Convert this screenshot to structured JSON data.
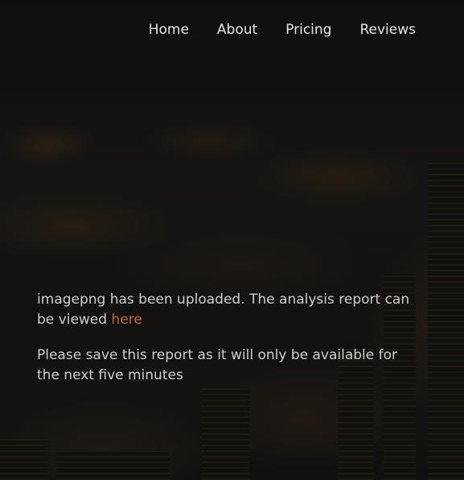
{
  "nav": {
    "items": [
      {
        "label": "Home"
      },
      {
        "label": "About"
      },
      {
        "label": "Pricing"
      },
      {
        "label": "Reviews"
      }
    ]
  },
  "message": {
    "upload_text": "imagepng has been uploaded. The analysis report can be viewed ",
    "link_label": "here",
    "save_notice": "Please save this report as it will only be available for the next five minutes"
  },
  "colors": {
    "link": "#c56b2e",
    "text": "#cfcfcf",
    "nav_text": "#e6e6e6"
  }
}
